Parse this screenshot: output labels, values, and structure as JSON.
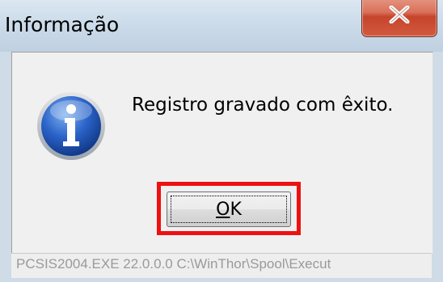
{
  "window": {
    "title": "Informação"
  },
  "message": {
    "text": "Registro gravado com êxito.",
    "icon": "info-icon"
  },
  "buttons": {
    "ok_mnemonic": "O",
    "ok_rest": "K",
    "close_icon": "close-icon"
  },
  "status": {
    "text": "PCSIS2004.EXE 22.0.0.0 C:\\WinThor\\Spool\\Execut"
  },
  "colors": {
    "highlight": "#ee1111",
    "close_button": "#c6442b",
    "icon_blue": "#1f56b8"
  }
}
